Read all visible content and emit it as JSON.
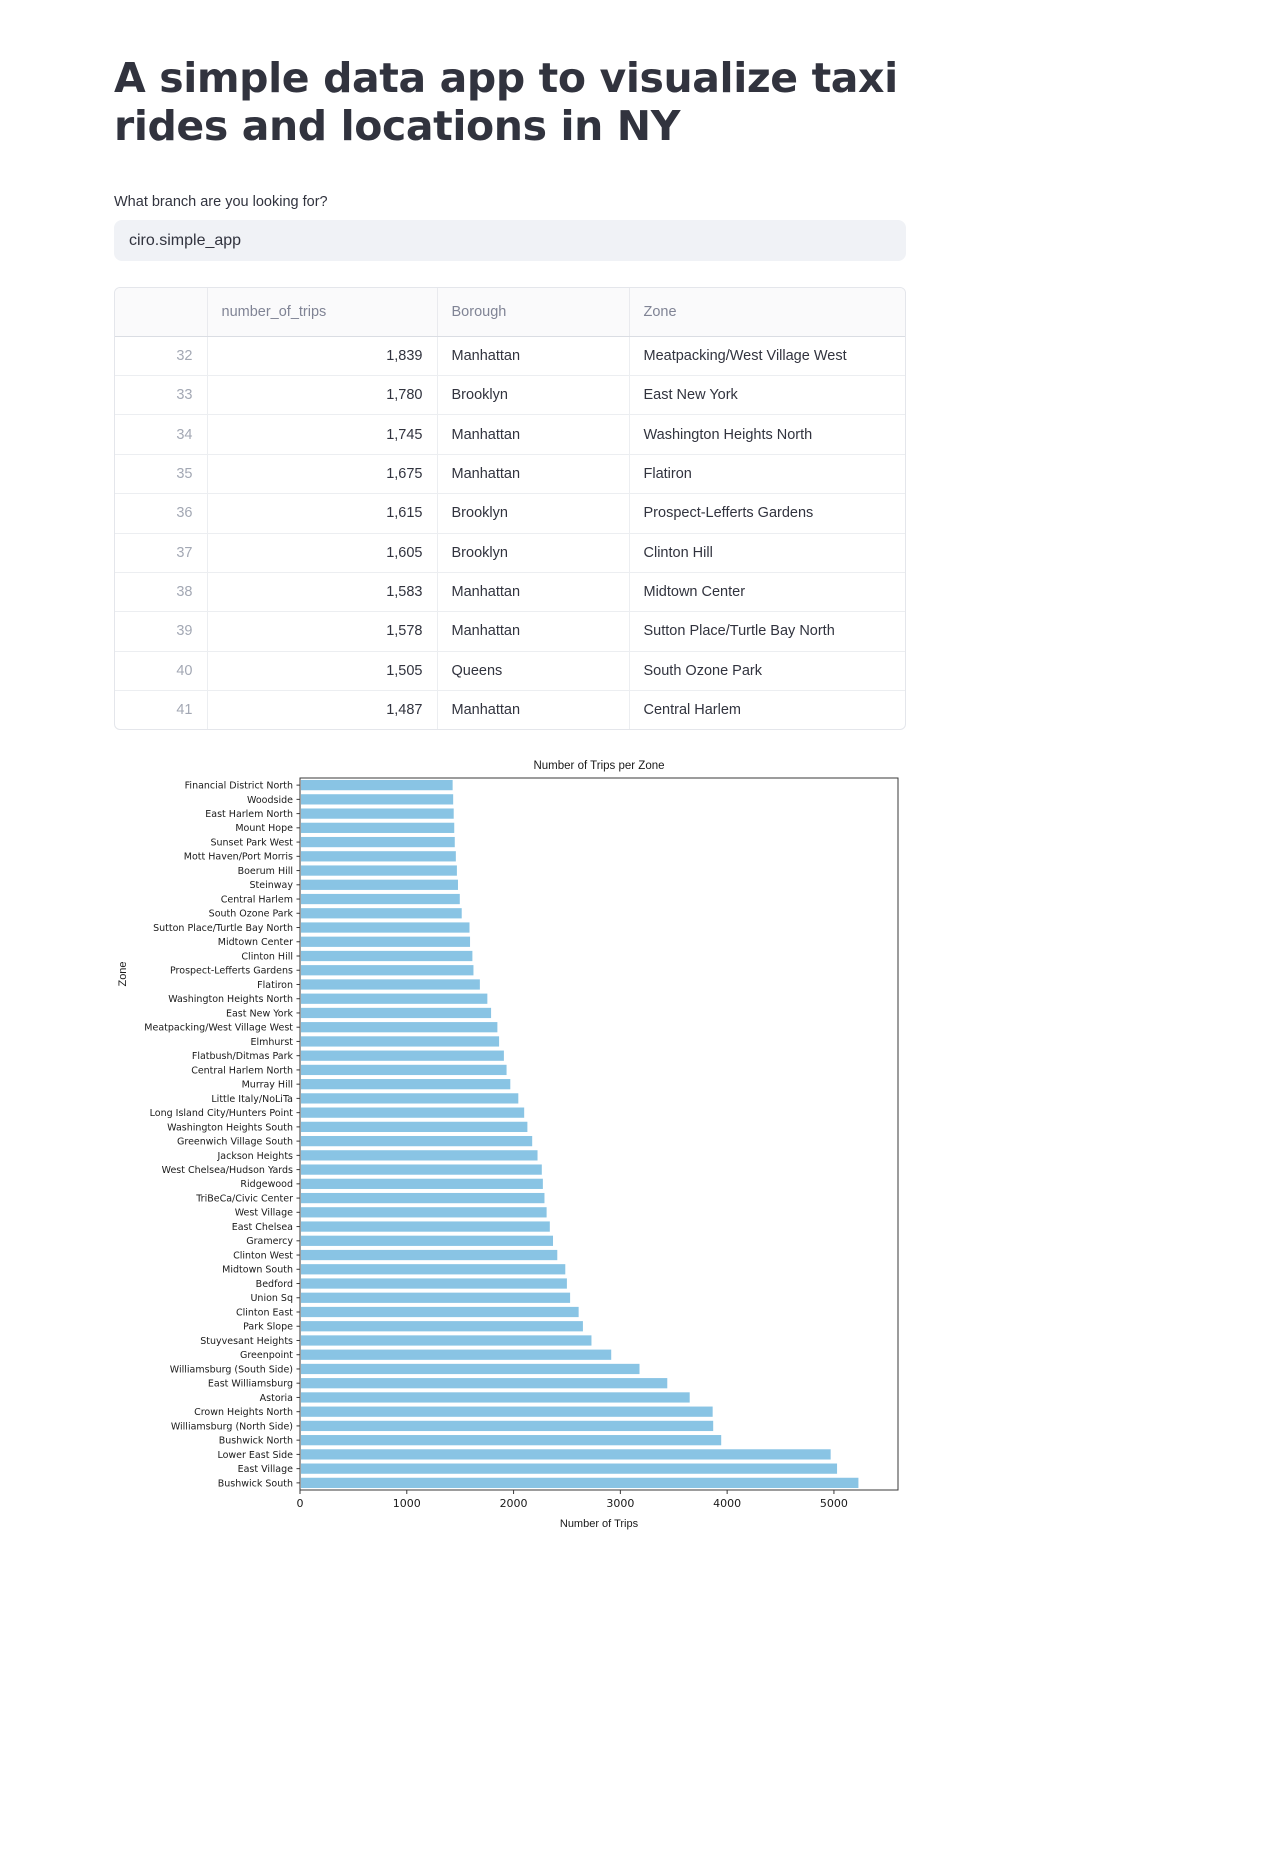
{
  "header": {
    "title": "A simple data app to visualize taxi rides and locations in NY"
  },
  "branch_input": {
    "label": "What branch are you looking for?",
    "value": "ciro.simple_app",
    "placeholder": "ciro.simple_app"
  },
  "dataframe": {
    "columns": [
      "",
      "number_of_trips",
      "Borough",
      "Zone",
      ""
    ],
    "rows": [
      {
        "index": "32",
        "number_of_trips": "1,839",
        "borough": "Manhattan",
        "zone": "Meatpacking/West Village West",
        "extra": ""
      },
      {
        "index": "33",
        "number_of_trips": "1,780",
        "borough": "Brooklyn",
        "zone": "East New York",
        "extra": ""
      },
      {
        "index": "34",
        "number_of_trips": "1,745",
        "borough": "Manhattan",
        "zone": "Washington Heights North",
        "extra": ""
      },
      {
        "index": "35",
        "number_of_trips": "1,675",
        "borough": "Manhattan",
        "zone": "Flatiron",
        "extra": ""
      },
      {
        "index": "36",
        "number_of_trips": "1,615",
        "borough": "Brooklyn",
        "zone": "Prospect-Lefferts Gardens",
        "extra": ""
      },
      {
        "index": "37",
        "number_of_trips": "1,605",
        "borough": "Brooklyn",
        "zone": "Clinton Hill",
        "extra": ""
      },
      {
        "index": "38",
        "number_of_trips": "1,583",
        "borough": "Manhattan",
        "zone": "Midtown Center",
        "extra": ""
      },
      {
        "index": "39",
        "number_of_trips": "1,578",
        "borough": "Manhattan",
        "zone": "Sutton Place/Turtle Bay North",
        "extra": ""
      },
      {
        "index": "40",
        "number_of_trips": "1,505",
        "borough": "Queens",
        "zone": "South Ozone Park",
        "extra": ""
      },
      {
        "index": "41",
        "number_of_trips": "1,487",
        "borough": "Manhattan",
        "zone": "Central Harlem",
        "extra": ""
      }
    ]
  },
  "chart_data": {
    "type": "bar",
    "orientation": "horizontal",
    "title": "Number of Trips per Zone",
    "xlabel": "Number of Trips",
    "ylabel": "Zone",
    "xlim": [
      0,
      5600
    ],
    "xticks": [
      0,
      1000,
      2000,
      3000,
      4000,
      5000
    ],
    "grid": false,
    "bar_color": "#89c4e4",
    "categories": [
      "Financial District North",
      "Woodside",
      "East Harlem North",
      "Mount Hope",
      "Sunset Park West",
      "Mott Haven/Port Morris",
      "Boerum Hill",
      "Steinway",
      "Central Harlem",
      "South Ozone Park",
      "Sutton Place/Turtle Bay North",
      "Midtown Center",
      "Clinton Hill",
      "Prospect-Lefferts Gardens",
      "Flatiron",
      "Washington Heights North",
      "East New York",
      "Meatpacking/West Village West",
      "Elmhurst",
      "Flatbush/Ditmas Park",
      "Central Harlem North",
      "Murray Hill",
      "Little Italy/NoLiTa",
      "Long Island City/Hunters Point",
      "Washington Heights South",
      "Greenwich Village South",
      "Jackson Heights",
      "West Chelsea/Hudson Yards",
      "Ridgewood",
      "TriBeCa/Civic Center",
      "West Village",
      "East Chelsea",
      "Gramercy",
      "Clinton West",
      "Midtown South",
      "Bedford",
      "Union Sq",
      "Clinton East",
      "Park Slope",
      "Stuyvesant Heights",
      "Greenpoint",
      "Williamsburg (South Side)",
      "East Williamsburg",
      "Astoria",
      "Crown Heights North",
      "Williamsburg (North Side)",
      "Bushwick North",
      "Lower East Side",
      "East Village",
      "Bushwick South"
    ],
    "values": [
      1420,
      1425,
      1430,
      1435,
      1440,
      1450,
      1460,
      1470,
      1487,
      1505,
      1578,
      1583,
      1605,
      1615,
      1675,
      1745,
      1780,
      1839,
      1855,
      1900,
      1925,
      1960,
      2035,
      2090,
      2120,
      2165,
      2215,
      2255,
      2265,
      2280,
      2300,
      2330,
      2360,
      2400,
      2475,
      2490,
      2520,
      2600,
      2640,
      2720,
      2905,
      3170,
      3430,
      3640,
      3855,
      3860,
      3935,
      4960,
      5020,
      5220
    ]
  }
}
